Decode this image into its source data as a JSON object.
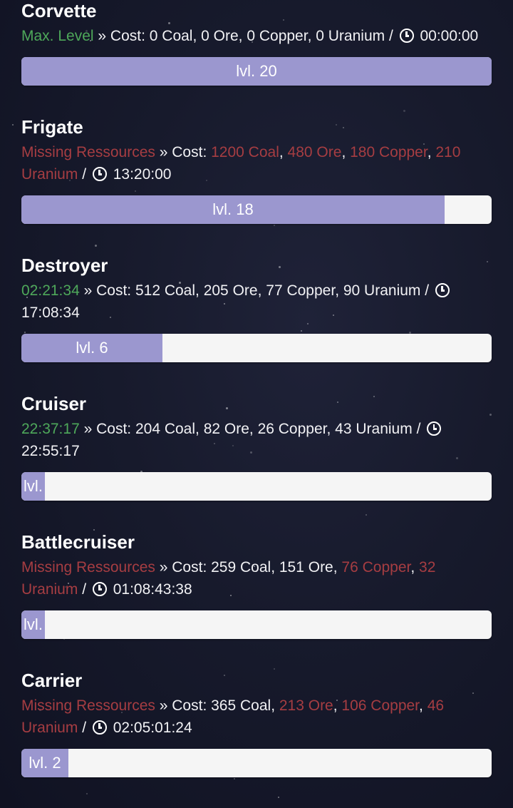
{
  "ships": [
    {
      "name": "Corvette",
      "status": {
        "text": "Max. Level",
        "color": "green"
      },
      "cost_label": "Cost:",
      "costs": [
        {
          "text": "0 Coal",
          "missing": false
        },
        {
          "text": "0 Ore",
          "missing": false
        },
        {
          "text": "0 Copper",
          "missing": false
        },
        {
          "text": "0 Uranium",
          "missing": false
        }
      ],
      "time": "00:00:00",
      "level_label": "lvl. 20",
      "level_fraction": 1.0
    },
    {
      "name": "Frigate",
      "status": {
        "text": "Missing Ressources",
        "color": "red"
      },
      "cost_label": "Cost:",
      "costs": [
        {
          "text": "1200 Coal",
          "missing": true
        },
        {
          "text": "480 Ore",
          "missing": true
        },
        {
          "text": "180 Copper",
          "missing": true
        },
        {
          "text": "210 Uranium",
          "missing": true
        }
      ],
      "time": "13:20:00",
      "level_label": "lvl. 18",
      "level_fraction": 0.9
    },
    {
      "name": "Destroyer",
      "status": {
        "text": "02:21:34",
        "color": "green"
      },
      "cost_label": "Cost:",
      "costs": [
        {
          "text": "512 Coal",
          "missing": false
        },
        {
          "text": "205 Ore",
          "missing": false
        },
        {
          "text": "77 Copper",
          "missing": false
        },
        {
          "text": "90 Uranium",
          "missing": false
        }
      ],
      "time": "17:08:34",
      "level_label": "lvl. 6",
      "level_fraction": 0.3
    },
    {
      "name": "Cruiser",
      "status": {
        "text": "22:37:17",
        "color": "green"
      },
      "cost_label": "Cost:",
      "costs": [
        {
          "text": "204 Coal",
          "missing": false
        },
        {
          "text": "82 Ore",
          "missing": false
        },
        {
          "text": "26 Copper",
          "missing": false
        },
        {
          "text": "43 Uranium",
          "missing": false
        }
      ],
      "time": "22:55:17",
      "level_label": "lvl.",
      "level_fraction": 0.05
    },
    {
      "name": "Battlecruiser",
      "status": {
        "text": "Missing Ressources",
        "color": "red"
      },
      "cost_label": "Cost:",
      "costs": [
        {
          "text": "259 Coal",
          "missing": false
        },
        {
          "text": "151 Ore",
          "missing": false
        },
        {
          "text": "76 Copper",
          "missing": true
        },
        {
          "text": "32 Uranium",
          "missing": true
        }
      ],
      "time": "01:08:43:38",
      "level_label": "lvl.",
      "level_fraction": 0.05
    },
    {
      "name": "Carrier",
      "status": {
        "text": "Missing Ressources",
        "color": "red"
      },
      "cost_label": "Cost:",
      "costs": [
        {
          "text": "365 Coal",
          "missing": false
        },
        {
          "text": "213 Ore",
          "missing": true
        },
        {
          "text": "106 Copper",
          "missing": true
        },
        {
          "text": "46 Uranium",
          "missing": true
        }
      ],
      "time": "02:05:01:24",
      "level_label": "lvl. 2",
      "level_fraction": 0.1
    }
  ],
  "colors": {
    "green": "#4ea85a",
    "red": "#a63d42",
    "bar_fill": "#9b97cf",
    "bar_track": "#f5f5f5"
  }
}
